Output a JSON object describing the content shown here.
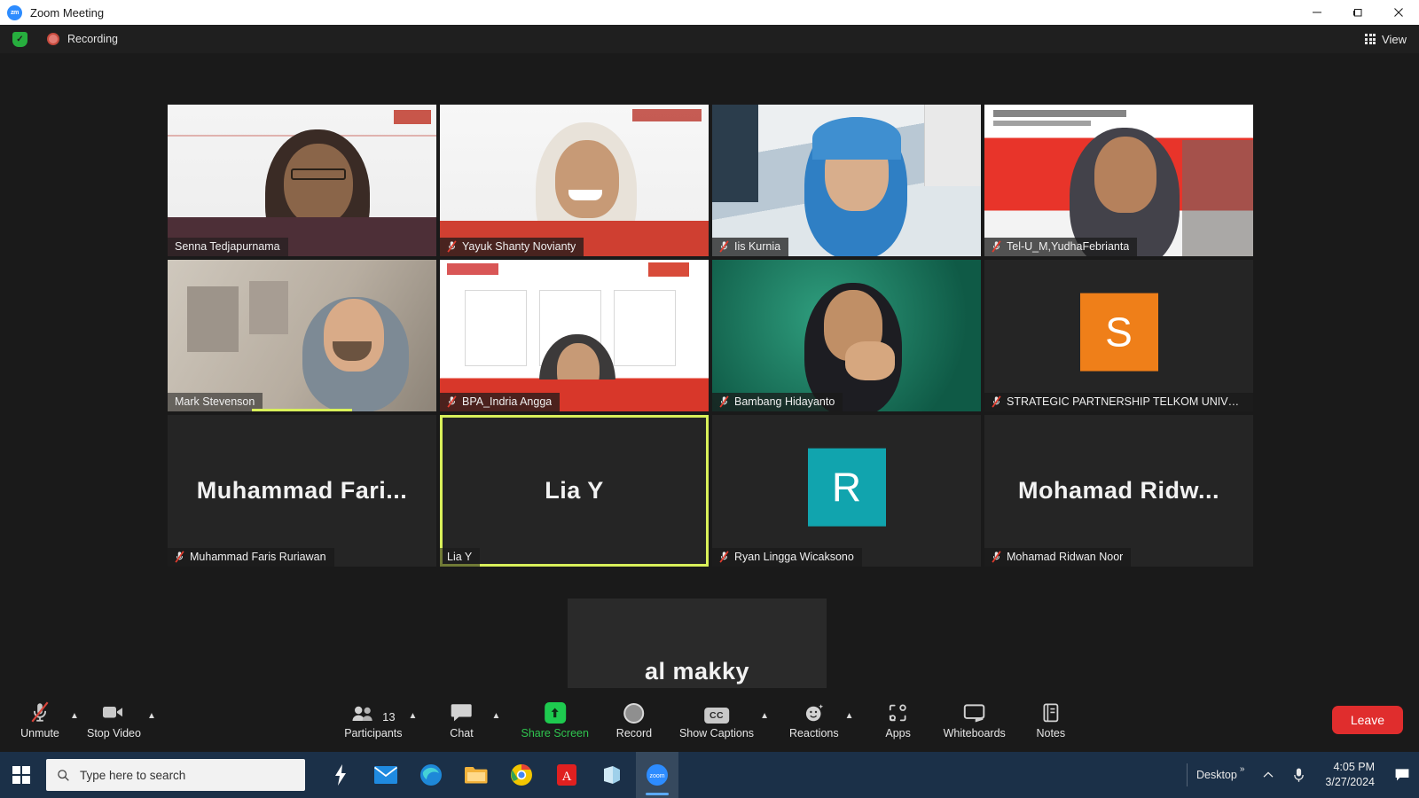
{
  "window": {
    "title": "Zoom Meeting",
    "app_badge": "zm",
    "minimize_label": "Minimize",
    "maximize_label": "Maximize",
    "close_label": "Close"
  },
  "topbar": {
    "encryption_label": "Encryption",
    "recording_label": "Recording",
    "view_label": "View"
  },
  "participants": [
    {
      "name": "Senna Tedjapurnama",
      "muted": false,
      "kind": "video",
      "style": "telkom1",
      "active": false
    },
    {
      "name": "Yayuk Shanty Novianty",
      "muted": true,
      "kind": "video",
      "style": "telkom2",
      "active": false
    },
    {
      "name": "Iis Kurnia",
      "muted": true,
      "kind": "video",
      "style": "hijab",
      "active": false
    },
    {
      "name": "Tel-U_M,YudhaFebrianta",
      "muted": true,
      "kind": "video",
      "style": "redbanner",
      "active": false
    },
    {
      "name": "Mark Stevenson",
      "muted": false,
      "kind": "video",
      "style": "office",
      "active": false
    },
    {
      "name": "BPA_Indria Angga",
      "muted": true,
      "kind": "video",
      "style": "slides",
      "active": false
    },
    {
      "name": "Bambang Hidayanto",
      "muted": true,
      "kind": "video",
      "style": "green",
      "active": false
    },
    {
      "name": "STRATEGIC PARTNERSHIP TELKOM UNIVERSI...",
      "muted": true,
      "kind": "avatar-square",
      "initial": "S",
      "avatar_color": "#ef7f19",
      "active": false
    },
    {
      "name": "Muhammad Faris Ruriawan",
      "muted": true,
      "kind": "name-only",
      "display": "Muhammad  Fari...",
      "active": false
    },
    {
      "name": "Lia Y",
      "muted": false,
      "kind": "name-only",
      "display": "Lia Y",
      "active": true
    },
    {
      "name": "Ryan Lingga Wicaksono",
      "muted": true,
      "kind": "avatar-square",
      "initial": "R",
      "avatar_color": "#11a4ae",
      "active": false
    },
    {
      "name": "Mohamad Ridwan Noor",
      "muted": true,
      "kind": "name-only",
      "display": "Mohamad  Ridw...",
      "active": false
    }
  ],
  "solo_participant": {
    "name": "al makky",
    "display": "al makky",
    "muted": true
  },
  "controls": {
    "left": [
      {
        "label": "Unmute",
        "icon": "microphone-muted-icon",
        "has_caret": true
      },
      {
        "label": "Stop Video",
        "icon": "video-camera-icon",
        "has_caret": true
      }
    ],
    "center": [
      {
        "label": "Participants",
        "icon": "people-icon",
        "badge": "13",
        "has_caret": true
      },
      {
        "label": "Chat",
        "icon": "chat-bubble-icon",
        "has_caret": true
      },
      {
        "label": "Share Screen",
        "icon": "share-screen-icon",
        "has_caret": false,
        "accent": "#2fc44e"
      },
      {
        "label": "Record",
        "icon": "record-circle-icon",
        "has_caret": false
      },
      {
        "label": "Show Captions",
        "icon": "closed-captions-icon",
        "has_caret": true
      },
      {
        "label": "Reactions",
        "icon": "reactions-smiley-icon",
        "has_caret": true
      },
      {
        "label": "Apps",
        "icon": "apps-icon",
        "has_caret": false
      },
      {
        "label": "Whiteboards",
        "icon": "whiteboard-icon",
        "has_caret": false
      },
      {
        "label": "Notes",
        "icon": "notes-icon",
        "has_caret": false
      }
    ],
    "leave_label": "Leave"
  },
  "taskbar": {
    "search_placeholder": "Type here to search",
    "apps": [
      {
        "name": "smart-switch-icon"
      },
      {
        "name": "mail-icon"
      },
      {
        "name": "microsoft-edge-icon"
      },
      {
        "name": "file-explorer-icon"
      },
      {
        "name": "google-chrome-icon"
      },
      {
        "name": "adobe-acrobat-icon"
      },
      {
        "name": "microsoft-store-icon"
      },
      {
        "name": "zoom-icon"
      }
    ],
    "desktop_label": "Desktop",
    "time": "4:05 PM",
    "date": "3/27/2024"
  },
  "colors": {
    "accent_active_tile": "#d9f05a",
    "leave_red": "#e02d2d",
    "share_green": "#2fc44e",
    "taskbar_blue": "#1b3048"
  }
}
